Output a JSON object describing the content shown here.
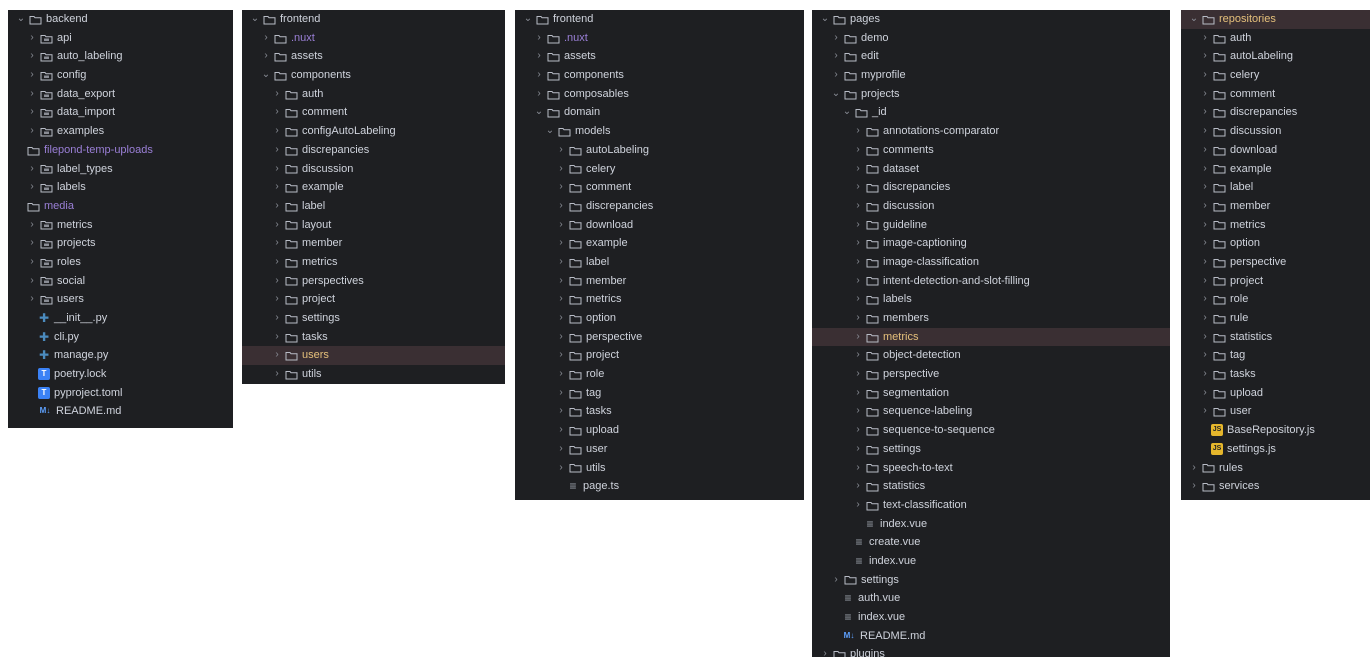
{
  "panels": [
    {
      "id": "backend",
      "rows": [
        {
          "d": 0,
          "c": "v",
          "i": "folder",
          "t": "backend"
        },
        {
          "d": 1,
          "c": ">",
          "i": "pkg",
          "t": "api"
        },
        {
          "d": 1,
          "c": ">",
          "i": "pkg",
          "t": "auto_labeling"
        },
        {
          "d": 1,
          "c": ">",
          "i": "pkg",
          "t": "config"
        },
        {
          "d": 1,
          "c": ">",
          "i": "pkg",
          "t": "data_export"
        },
        {
          "d": 1,
          "c": ">",
          "i": "pkg",
          "t": "data_import"
        },
        {
          "d": 1,
          "c": ">",
          "i": "pkg",
          "t": "examples"
        },
        {
          "d": 1,
          "c": "",
          "i": "folder",
          "t": "filepond-temp-uploads",
          "s": "muted"
        },
        {
          "d": 1,
          "c": ">",
          "i": "pkg",
          "t": "label_types"
        },
        {
          "d": 1,
          "c": ">",
          "i": "pkg",
          "t": "labels"
        },
        {
          "d": 1,
          "c": "",
          "i": "folder",
          "t": "media",
          "s": "muted"
        },
        {
          "d": 1,
          "c": ">",
          "i": "pkg",
          "t": "metrics"
        },
        {
          "d": 1,
          "c": ">",
          "i": "pkg",
          "t": "projects"
        },
        {
          "d": 1,
          "c": ">",
          "i": "pkg",
          "t": "roles"
        },
        {
          "d": 1,
          "c": ">",
          "i": "pkg",
          "t": "social"
        },
        {
          "d": 1,
          "c": ">",
          "i": "pkg",
          "t": "users"
        },
        {
          "d": 2,
          "c": "",
          "i": "py",
          "t": "__init__.py"
        },
        {
          "d": 2,
          "c": "",
          "i": "py",
          "t": "cli.py"
        },
        {
          "d": 2,
          "c": "",
          "i": "py",
          "t": "manage.py"
        },
        {
          "d": 2,
          "c": "",
          "i": "toml",
          "t": "poetry.lock"
        },
        {
          "d": 2,
          "c": "",
          "i": "toml",
          "t": "pyproject.toml"
        },
        {
          "d": 2,
          "c": "",
          "i": "md",
          "t": "README.md"
        }
      ]
    },
    {
      "id": "frontend-components",
      "rows": [
        {
          "d": 0,
          "c": "v",
          "i": "folder",
          "t": "frontend"
        },
        {
          "d": 1,
          "c": ">",
          "i": "folder",
          "t": ".nuxt",
          "s": "muted"
        },
        {
          "d": 1,
          "c": ">",
          "i": "folder",
          "t": "assets"
        },
        {
          "d": 1,
          "c": "v",
          "i": "folder",
          "t": "components"
        },
        {
          "d": 2,
          "c": ">",
          "i": "folder",
          "t": "auth"
        },
        {
          "d": 2,
          "c": ">",
          "i": "folder",
          "t": "comment"
        },
        {
          "d": 2,
          "c": ">",
          "i": "folder",
          "t": "configAutoLabeling"
        },
        {
          "d": 2,
          "c": ">",
          "i": "folder",
          "t": "discrepancies"
        },
        {
          "d": 2,
          "c": ">",
          "i": "folder",
          "t": "discussion"
        },
        {
          "d": 2,
          "c": ">",
          "i": "folder",
          "t": "example"
        },
        {
          "d": 2,
          "c": ">",
          "i": "folder",
          "t": "label"
        },
        {
          "d": 2,
          "c": ">",
          "i": "folder",
          "t": "layout"
        },
        {
          "d": 2,
          "c": ">",
          "i": "folder",
          "t": "member"
        },
        {
          "d": 2,
          "c": ">",
          "i": "folder",
          "t": "metrics"
        },
        {
          "d": 2,
          "c": ">",
          "i": "folder",
          "t": "perspectives"
        },
        {
          "d": 2,
          "c": ">",
          "i": "folder",
          "t": "project"
        },
        {
          "d": 2,
          "c": ">",
          "i": "folder",
          "t": "settings"
        },
        {
          "d": 2,
          "c": ">",
          "i": "folder",
          "t": "tasks"
        },
        {
          "d": 2,
          "c": ">",
          "i": "folder",
          "t": "users",
          "s": "hl",
          "sel": true
        },
        {
          "d": 2,
          "c": ">",
          "i": "folder",
          "t": "utils"
        }
      ]
    },
    {
      "id": "frontend-domain",
      "rows": [
        {
          "d": 0,
          "c": "v",
          "i": "folder",
          "t": "frontend"
        },
        {
          "d": 1,
          "c": ">",
          "i": "folder",
          "t": ".nuxt",
          "s": "muted"
        },
        {
          "d": 1,
          "c": ">",
          "i": "folder",
          "t": "assets"
        },
        {
          "d": 1,
          "c": ">",
          "i": "folder",
          "t": "components"
        },
        {
          "d": 1,
          "c": ">",
          "i": "folder",
          "t": "composables"
        },
        {
          "d": 1,
          "c": "v",
          "i": "folder",
          "t": "domain"
        },
        {
          "d": 2,
          "c": "v",
          "i": "folder",
          "t": "models"
        },
        {
          "d": 3,
          "c": ">",
          "i": "folder",
          "t": "autoLabeling"
        },
        {
          "d": 3,
          "c": ">",
          "i": "folder",
          "t": "celery"
        },
        {
          "d": 3,
          "c": ">",
          "i": "folder",
          "t": "comment"
        },
        {
          "d": 3,
          "c": ">",
          "i": "folder",
          "t": "discrepancies"
        },
        {
          "d": 3,
          "c": ">",
          "i": "folder",
          "t": "download"
        },
        {
          "d": 3,
          "c": ">",
          "i": "folder",
          "t": "example"
        },
        {
          "d": 3,
          "c": ">",
          "i": "folder",
          "t": "label"
        },
        {
          "d": 3,
          "c": ">",
          "i": "folder",
          "t": "member"
        },
        {
          "d": 3,
          "c": ">",
          "i": "folder",
          "t": "metrics"
        },
        {
          "d": 3,
          "c": ">",
          "i": "folder",
          "t": "option"
        },
        {
          "d": 3,
          "c": ">",
          "i": "folder",
          "t": "perspective"
        },
        {
          "d": 3,
          "c": ">",
          "i": "folder",
          "t": "project"
        },
        {
          "d": 3,
          "c": ">",
          "i": "folder",
          "t": "role"
        },
        {
          "d": 3,
          "c": ">",
          "i": "folder",
          "t": "tag"
        },
        {
          "d": 3,
          "c": ">",
          "i": "folder",
          "t": "tasks"
        },
        {
          "d": 3,
          "c": ">",
          "i": "folder",
          "t": "upload"
        },
        {
          "d": 3,
          "c": ">",
          "i": "folder",
          "t": "user"
        },
        {
          "d": 3,
          "c": ">",
          "i": "folder",
          "t": "utils"
        },
        {
          "d": 4,
          "c": "",
          "i": "txt",
          "t": "page.ts"
        }
      ]
    },
    {
      "id": "pages",
      "rows": [
        {
          "d": 0,
          "c": "v",
          "i": "folder",
          "t": "pages"
        },
        {
          "d": 1,
          "c": ">",
          "i": "folder",
          "t": "demo"
        },
        {
          "d": 1,
          "c": ">",
          "i": "folder",
          "t": "edit"
        },
        {
          "d": 1,
          "c": ">",
          "i": "folder",
          "t": "myprofile"
        },
        {
          "d": 1,
          "c": "v",
          "i": "folder",
          "t": "projects"
        },
        {
          "d": 2,
          "c": "v",
          "i": "folder",
          "t": "_id"
        },
        {
          "d": 3,
          "c": ">",
          "i": "folder",
          "t": "annotations-comparator"
        },
        {
          "d": 3,
          "c": ">",
          "i": "folder",
          "t": "comments"
        },
        {
          "d": 3,
          "c": ">",
          "i": "folder",
          "t": "dataset"
        },
        {
          "d": 3,
          "c": ">",
          "i": "folder",
          "t": "discrepancies"
        },
        {
          "d": 3,
          "c": ">",
          "i": "folder",
          "t": "discussion"
        },
        {
          "d": 3,
          "c": ">",
          "i": "folder",
          "t": "guideline"
        },
        {
          "d": 3,
          "c": ">",
          "i": "folder",
          "t": "image-captioning"
        },
        {
          "d": 3,
          "c": ">",
          "i": "folder",
          "t": "image-classification"
        },
        {
          "d": 3,
          "c": ">",
          "i": "folder",
          "t": "intent-detection-and-slot-filling"
        },
        {
          "d": 3,
          "c": ">",
          "i": "folder",
          "t": "labels"
        },
        {
          "d": 3,
          "c": ">",
          "i": "folder",
          "t": "members"
        },
        {
          "d": 3,
          "c": ">",
          "i": "folder",
          "t": "metrics",
          "s": "hl",
          "sel": true
        },
        {
          "d": 3,
          "c": ">",
          "i": "folder",
          "t": "object-detection"
        },
        {
          "d": 3,
          "c": ">",
          "i": "folder",
          "t": "perspective"
        },
        {
          "d": 3,
          "c": ">",
          "i": "folder",
          "t": "segmentation"
        },
        {
          "d": 3,
          "c": ">",
          "i": "folder",
          "t": "sequence-labeling"
        },
        {
          "d": 3,
          "c": ">",
          "i": "folder",
          "t": "sequence-to-sequence"
        },
        {
          "d": 3,
          "c": ">",
          "i": "folder",
          "t": "settings"
        },
        {
          "d": 3,
          "c": ">",
          "i": "folder",
          "t": "speech-to-text"
        },
        {
          "d": 3,
          "c": ">",
          "i": "folder",
          "t": "statistics"
        },
        {
          "d": 3,
          "c": ">",
          "i": "folder",
          "t": "text-classification"
        },
        {
          "d": 4,
          "c": "",
          "i": "txt",
          "t": "index.vue"
        },
        {
          "d": 3,
          "c": "",
          "i": "txt",
          "t": "create.vue"
        },
        {
          "d": 3,
          "c": "",
          "i": "txt",
          "t": "index.vue"
        },
        {
          "d": 1,
          "c": ">",
          "i": "folder",
          "t": "settings"
        },
        {
          "d": 2,
          "c": "",
          "i": "txt",
          "t": "auth.vue"
        },
        {
          "d": 2,
          "c": "",
          "i": "txt",
          "t": "index.vue"
        },
        {
          "d": 2,
          "c": "",
          "i": "md",
          "t": "README.md"
        },
        {
          "d": 0,
          "c": ">",
          "i": "folder",
          "t": "plugins"
        }
      ]
    },
    {
      "id": "repositories",
      "rows": [
        {
          "d": 0,
          "c": "v",
          "i": "folder",
          "t": "repositories",
          "s": "hl",
          "sel": true
        },
        {
          "d": 1,
          "c": ">",
          "i": "folder",
          "t": "auth"
        },
        {
          "d": 1,
          "c": ">",
          "i": "folder",
          "t": "autoLabeling"
        },
        {
          "d": 1,
          "c": ">",
          "i": "folder",
          "t": "celery"
        },
        {
          "d": 1,
          "c": ">",
          "i": "folder",
          "t": "comment"
        },
        {
          "d": 1,
          "c": ">",
          "i": "folder",
          "t": "discrepancies"
        },
        {
          "d": 1,
          "c": ">",
          "i": "folder",
          "t": "discussion"
        },
        {
          "d": 1,
          "c": ">",
          "i": "folder",
          "t": "download"
        },
        {
          "d": 1,
          "c": ">",
          "i": "folder",
          "t": "example"
        },
        {
          "d": 1,
          "c": ">",
          "i": "folder",
          "t": "label"
        },
        {
          "d": 1,
          "c": ">",
          "i": "folder",
          "t": "member"
        },
        {
          "d": 1,
          "c": ">",
          "i": "folder",
          "t": "metrics"
        },
        {
          "d": 1,
          "c": ">",
          "i": "folder",
          "t": "option"
        },
        {
          "d": 1,
          "c": ">",
          "i": "folder",
          "t": "perspective"
        },
        {
          "d": 1,
          "c": ">",
          "i": "folder",
          "t": "project"
        },
        {
          "d": 1,
          "c": ">",
          "i": "folder",
          "t": "role"
        },
        {
          "d": 1,
          "c": ">",
          "i": "folder",
          "t": "rule"
        },
        {
          "d": 1,
          "c": ">",
          "i": "folder",
          "t": "statistics"
        },
        {
          "d": 1,
          "c": ">",
          "i": "folder",
          "t": "tag"
        },
        {
          "d": 1,
          "c": ">",
          "i": "folder",
          "t": "tasks"
        },
        {
          "d": 1,
          "c": ">",
          "i": "folder",
          "t": "upload"
        },
        {
          "d": 1,
          "c": ">",
          "i": "folder",
          "t": "user"
        },
        {
          "d": 2,
          "c": "",
          "i": "js",
          "t": "BaseRepository.js"
        },
        {
          "d": 2,
          "c": "",
          "i": "js",
          "t": "settings.js"
        },
        {
          "d": 0,
          "c": ">",
          "i": "folder",
          "t": "rules"
        },
        {
          "d": 0,
          "c": ">",
          "i": "folder",
          "t": "services"
        }
      ]
    }
  ],
  "icon_badges": {
    "md": "M↓",
    "toml": "T",
    "js": "JS"
  },
  "colors": {
    "panel_bg": "#1e1f22",
    "text": "#cfd3dc",
    "muted": "#9a7fd6",
    "highlight": "#e5c07b",
    "selection_bg": "#3a2f33"
  }
}
